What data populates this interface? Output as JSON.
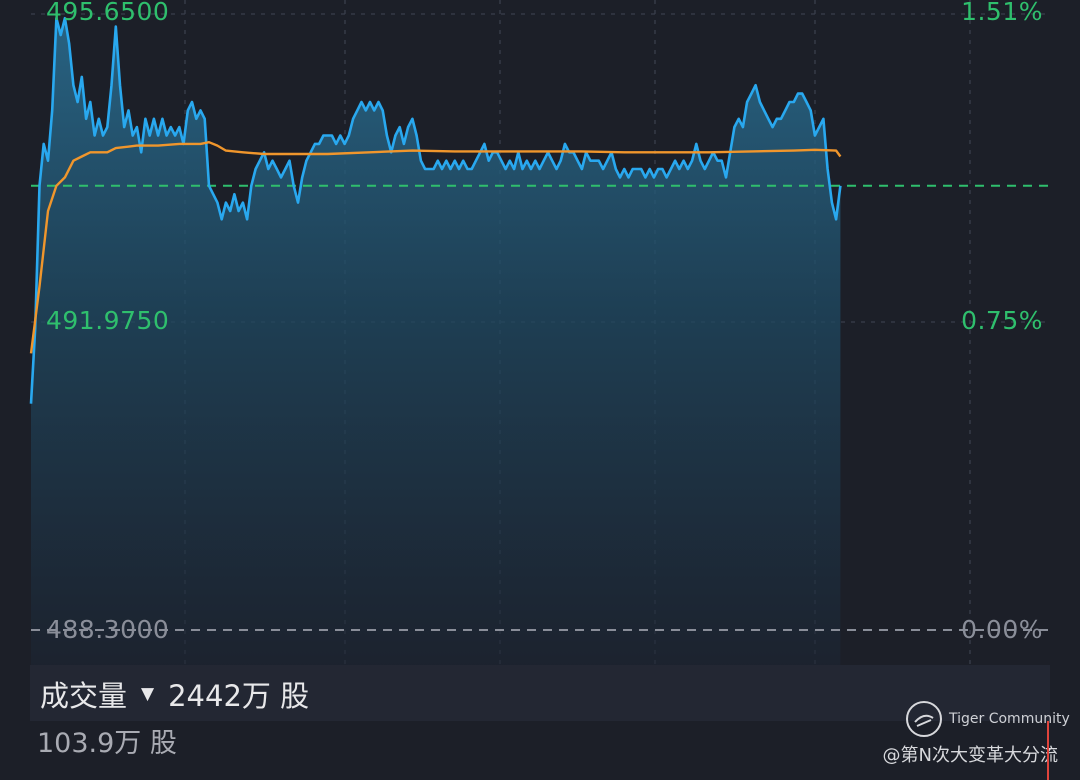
{
  "chart_data": {
    "type": "line",
    "title": "",
    "price_axis": {
      "top": "495.6500",
      "mid": "491.9750",
      "bottom": "488.3000"
    },
    "percent_axis": {
      "top": "1.51%",
      "mid": "0.75%",
      "bottom": "0.00%"
    },
    "ylim": [
      488.3,
      495.65
    ],
    "x_range": [
      0,
      240
    ],
    "baseline": 493.6,
    "colors": {
      "price": "#29a8ef",
      "avg": "#f0962c",
      "baseline": "#2fbf6d",
      "axis_text": "#2fbf6d",
      "grid": "#3a3f4c"
    },
    "series": [
      {
        "key": "price",
        "values": [
          [
            0,
            491.0
          ],
          [
            1,
            491.9
          ],
          [
            2,
            493.6
          ],
          [
            3,
            494.1
          ],
          [
            4,
            493.9
          ],
          [
            5,
            494.5
          ],
          [
            6,
            495.6
          ],
          [
            7,
            495.4
          ],
          [
            8,
            495.6
          ],
          [
            9,
            495.3
          ],
          [
            10,
            494.8
          ],
          [
            11,
            494.6
          ],
          [
            12,
            494.9
          ],
          [
            13,
            494.4
          ],
          [
            14,
            494.6
          ],
          [
            15,
            494.2
          ],
          [
            16,
            494.4
          ],
          [
            17,
            494.2
          ],
          [
            18,
            494.3
          ],
          [
            19,
            494.8
          ],
          [
            20,
            495.5
          ],
          [
            21,
            494.8
          ],
          [
            22,
            494.3
          ],
          [
            23,
            494.5
          ],
          [
            24,
            494.2
          ],
          [
            25,
            494.3
          ],
          [
            26,
            494.0
          ],
          [
            27,
            494.4
          ],
          [
            28,
            494.2
          ],
          [
            29,
            494.4
          ],
          [
            30,
            494.2
          ],
          [
            31,
            494.4
          ],
          [
            32,
            494.2
          ],
          [
            33,
            494.3
          ],
          [
            34,
            494.2
          ],
          [
            35,
            494.3
          ],
          [
            36,
            494.1
          ],
          [
            37,
            494.5
          ],
          [
            38,
            494.6
          ],
          [
            39,
            494.4
          ],
          [
            40,
            494.5
          ],
          [
            41,
            494.4
          ],
          [
            42,
            493.6
          ],
          [
            43,
            493.5
          ],
          [
            44,
            493.4
          ],
          [
            45,
            493.2
          ],
          [
            46,
            493.4
          ],
          [
            47,
            493.3
          ],
          [
            48,
            493.5
          ],
          [
            49,
            493.3
          ],
          [
            50,
            493.4
          ],
          [
            51,
            493.2
          ],
          [
            52,
            493.6
          ],
          [
            53,
            493.8
          ],
          [
            54,
            493.9
          ],
          [
            55,
            494.0
          ],
          [
            56,
            493.8
          ],
          [
            57,
            493.9
          ],
          [
            58,
            493.8
          ],
          [
            59,
            493.7
          ],
          [
            60,
            493.8
          ],
          [
            61,
            493.9
          ],
          [
            62,
            493.6
          ],
          [
            63,
            493.4
          ],
          [
            64,
            493.7
          ],
          [
            65,
            493.9
          ],
          [
            66,
            494.0
          ],
          [
            67,
            494.1
          ],
          [
            68,
            494.1
          ],
          [
            69,
            494.2
          ],
          [
            70,
            494.2
          ],
          [
            71,
            494.2
          ],
          [
            72,
            494.1
          ],
          [
            73,
            494.2
          ],
          [
            74,
            494.1
          ],
          [
            75,
            494.2
          ],
          [
            76,
            494.4
          ],
          [
            77,
            494.5
          ],
          [
            78,
            494.6
          ],
          [
            79,
            494.5
          ],
          [
            80,
            494.6
          ],
          [
            81,
            494.5
          ],
          [
            82,
            494.6
          ],
          [
            83,
            494.5
          ],
          [
            84,
            494.2
          ],
          [
            85,
            494.0
          ],
          [
            86,
            494.2
          ],
          [
            87,
            494.3
          ],
          [
            88,
            494.1
          ],
          [
            89,
            494.3
          ],
          [
            90,
            494.4
          ],
          [
            91,
            494.2
          ],
          [
            92,
            493.9
          ],
          [
            93,
            493.8
          ],
          [
            94,
            493.8
          ],
          [
            95,
            493.8
          ],
          [
            96,
            493.9
          ],
          [
            97,
            493.8
          ],
          [
            98,
            493.9
          ],
          [
            99,
            493.8
          ],
          [
            100,
            493.9
          ],
          [
            101,
            493.8
          ],
          [
            102,
            493.9
          ],
          [
            103,
            493.8
          ],
          [
            104,
            493.8
          ],
          [
            105,
            493.9
          ],
          [
            106,
            494.0
          ],
          [
            107,
            494.1
          ],
          [
            108,
            493.9
          ],
          [
            109,
            494.0
          ],
          [
            110,
            494.0
          ],
          [
            111,
            493.9
          ],
          [
            112,
            493.8
          ],
          [
            113,
            493.9
          ],
          [
            114,
            493.8
          ],
          [
            115,
            494.0
          ],
          [
            116,
            493.8
          ],
          [
            117,
            493.9
          ],
          [
            118,
            493.8
          ],
          [
            119,
            493.9
          ],
          [
            120,
            493.8
          ],
          [
            121,
            493.9
          ],
          [
            122,
            494.0
          ],
          [
            123,
            493.9
          ],
          [
            124,
            493.8
          ],
          [
            125,
            493.9
          ],
          [
            126,
            494.1
          ],
          [
            127,
            494.0
          ],
          [
            128,
            494.0
          ],
          [
            129,
            493.9
          ],
          [
            130,
            493.8
          ],
          [
            131,
            494.0
          ],
          [
            132,
            493.9
          ],
          [
            133,
            493.9
          ],
          [
            134,
            493.9
          ],
          [
            135,
            493.8
          ],
          [
            136,
            493.9
          ],
          [
            137,
            494.0
          ],
          [
            138,
            493.8
          ],
          [
            139,
            493.7
          ],
          [
            140,
            493.8
          ],
          [
            141,
            493.7
          ],
          [
            142,
            493.8
          ],
          [
            143,
            493.8
          ],
          [
            144,
            493.8
          ],
          [
            145,
            493.7
          ],
          [
            146,
            493.8
          ],
          [
            147,
            493.7
          ],
          [
            148,
            493.8
          ],
          [
            149,
            493.8
          ],
          [
            150,
            493.7
          ],
          [
            151,
            493.8
          ],
          [
            152,
            493.9
          ],
          [
            153,
            493.8
          ],
          [
            154,
            493.9
          ],
          [
            155,
            493.8
          ],
          [
            156,
            493.9
          ],
          [
            157,
            494.1
          ],
          [
            158,
            493.9
          ],
          [
            159,
            493.8
          ],
          [
            160,
            493.9
          ],
          [
            161,
            494.0
          ],
          [
            162,
            493.9
          ],
          [
            163,
            493.9
          ],
          [
            164,
            493.7
          ],
          [
            165,
            494.0
          ],
          [
            166,
            494.3
          ],
          [
            167,
            494.4
          ],
          [
            168,
            494.3
          ],
          [
            169,
            494.6
          ],
          [
            170,
            494.7
          ],
          [
            171,
            494.8
          ],
          [
            172,
            494.6
          ],
          [
            173,
            494.5
          ],
          [
            174,
            494.4
          ],
          [
            175,
            494.3
          ],
          [
            176,
            494.4
          ],
          [
            177,
            494.4
          ],
          [
            178,
            494.5
          ],
          [
            179,
            494.6
          ],
          [
            180,
            494.6
          ],
          [
            181,
            494.7
          ],
          [
            182,
            494.7
          ],
          [
            183,
            494.6
          ],
          [
            184,
            494.5
          ],
          [
            185,
            494.2
          ],
          [
            186,
            494.3
          ],
          [
            187,
            494.4
          ],
          [
            188,
            493.8
          ],
          [
            189,
            493.4
          ],
          [
            190,
            493.2
          ],
          [
            191,
            493.6
          ]
        ]
      },
      {
        "key": "avg",
        "values": [
          [
            0,
            491.6
          ],
          [
            2,
            492.4
          ],
          [
            4,
            493.3
          ],
          [
            6,
            493.6
          ],
          [
            8,
            493.7
          ],
          [
            10,
            493.9
          ],
          [
            12,
            493.95
          ],
          [
            14,
            494.0
          ],
          [
            16,
            494.0
          ],
          [
            18,
            494.0
          ],
          [
            20,
            494.05
          ],
          [
            25,
            494.08
          ],
          [
            30,
            494.08
          ],
          [
            35,
            494.1
          ],
          [
            40,
            494.1
          ],
          [
            42,
            494.12
          ],
          [
            44,
            494.08
          ],
          [
            46,
            494.02
          ],
          [
            50,
            494.0
          ],
          [
            55,
            493.98
          ],
          [
            60,
            493.98
          ],
          [
            70,
            493.98
          ],
          [
            80,
            494.0
          ],
          [
            90,
            494.02
          ],
          [
            100,
            494.01
          ],
          [
            110,
            494.01
          ],
          [
            120,
            494.01
          ],
          [
            130,
            494.01
          ],
          [
            140,
            494.0
          ],
          [
            150,
            494.0
          ],
          [
            160,
            494.0
          ],
          [
            170,
            494.01
          ],
          [
            180,
            494.02
          ],
          [
            185,
            494.03
          ],
          [
            190,
            494.02
          ],
          [
            191,
            493.95
          ]
        ]
      }
    ]
  },
  "volume": {
    "label": "成交量",
    "value": "2442万 股",
    "sub_value": "103.9万 股"
  },
  "watermark": {
    "brand": "Tiger Community",
    "user": "@第N次大变革大分流"
  }
}
